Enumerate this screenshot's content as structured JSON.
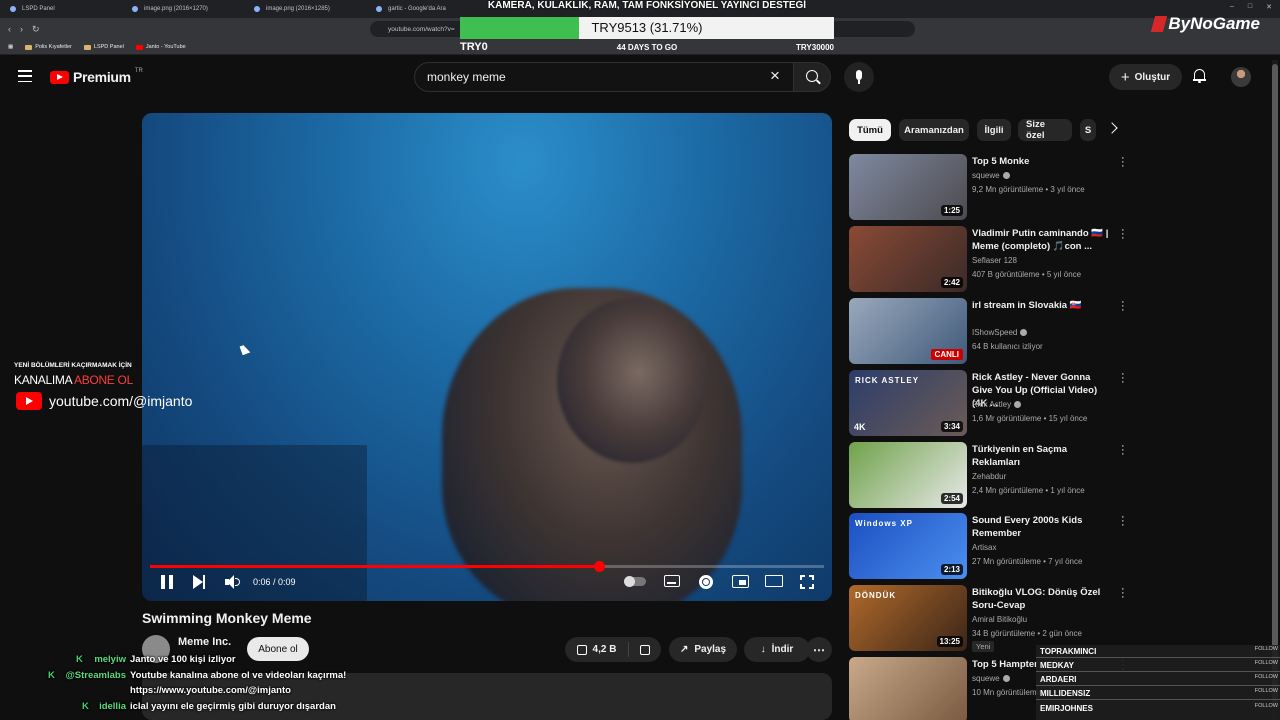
{
  "browser": {
    "tabs": [
      {
        "label": "LSPD Panel"
      },
      {
        "label": "image.png (2016×1270)"
      },
      {
        "label": "image.png (2016×1285)"
      },
      {
        "label": "gartic - Google'da Ara"
      }
    ],
    "url": "youtube.com/watch?v=",
    "bookmarks": [
      {
        "label": "Polis Kıyafetler"
      },
      {
        "label": "LSPD Panel"
      },
      {
        "label": "Janto - YouTube"
      }
    ]
  },
  "donation": {
    "title": "KAMERA, KULAKLIK, RAM, TAM FONKSİYONEL YAYINCI DESTEĞİ",
    "progress_text": "TRY9513 (31.71%)",
    "progress_fraction": 0.3171,
    "min_label": "TRY0",
    "days_left": "44 DAYS TO GO",
    "max_label": "TRY30000"
  },
  "brand_logo": "ByNoGame",
  "header": {
    "logo_text": "Premium",
    "country_code": "TR",
    "search_value": "monkey meme",
    "create_label": "Oluştur"
  },
  "player": {
    "time": "0:06 / 0:09",
    "progress_fraction": 0.6667
  },
  "video": {
    "title": "Swimming Monkey Meme",
    "channel": "Meme Inc.",
    "subscribe_label": "Abone ol",
    "likes": "4,2 B",
    "share_label": "Paylaş",
    "download_label": "İndir"
  },
  "chips": [
    "Tümü",
    "Aramanızdan",
    "İlgili",
    "Size özel",
    "S"
  ],
  "recommendations": [
    {
      "title": "Top 5 Monke",
      "channel": "squewe",
      "verified": true,
      "meta": "9,2 Mn görüntüleme • 3 yıl önce",
      "duration": "1:25",
      "thumb": [
        "#7e8aa0",
        "#4d4a4f"
      ]
    },
    {
      "title": "Vladimir Putin caminando 🇷🇺 | Meme (completo) 🎵con ...",
      "channel": "Seflaser 128",
      "verified": false,
      "meta": "407 B görüntüleme • 5 yıl önce",
      "duration": "2:42",
      "thumb": [
        "#8a4a35",
        "#3a2a28"
      ]
    },
    {
      "title": "irl stream in Slovakia 🇸🇰",
      "channel": "IShowSpeed",
      "verified": true,
      "meta": "64 B kullanıcı izliyor",
      "live": "CANLI",
      "thumb": [
        "#9aa9bc",
        "#3f5a7a"
      ]
    },
    {
      "title": "Rick Astley - Never Gonna Give You Up (Official Video) (4K ...",
      "channel": "Rick Astley",
      "verified": true,
      "meta": "1,6 Mr görüntüleme • 15 yıl önce",
      "duration": "3:34",
      "thumb_text": "RICK ASTLEY",
      "thumb_badge": "4K",
      "thumb": [
        "#2c3d6a",
        "#6b5b57"
      ]
    },
    {
      "title": "Türkiyenin en Saçma Reklamları",
      "channel": "Zehabdur",
      "verified": false,
      "meta": "2,4 Mn görüntüleme • 1 yıl önce",
      "duration": "2:54",
      "thumb": [
        "#6fa24a",
        "#e8e8e8"
      ]
    },
    {
      "title": "Sound Every 2000s Kids Remember",
      "channel": "Artisax",
      "verified": false,
      "meta": "27 Mn görüntüleme • 7 yıl önce",
      "duration": "2:13",
      "thumb_text": "Windows XP",
      "thumb": [
        "#1c4fc0",
        "#4b8ff0"
      ]
    },
    {
      "title": "Bitikoğlu VLOG: Dönüş Özel Soru-Cevap",
      "channel": "Amiral Bitikoğlu",
      "verified": false,
      "meta": "34 B görüntüleme • 2 gün önce",
      "duration": "13:25",
      "thumb_text": "DÖNDÜK",
      "badge": "Yeni",
      "thumb": [
        "#b06a2a",
        "#3b2518"
      ]
    },
    {
      "title": "Top 5 Hampter",
      "channel": "squewe",
      "verified": true,
      "meta": "10 Mn görüntüleme",
      "thumb": [
        "#c9a98a",
        "#7a5a40"
      ]
    }
  ],
  "overlay": {
    "small": "YENİ BÖLÜMLERİ KAÇIRMAMAK İÇİN",
    "big_prefix": "KANALIMA ",
    "big_red": "ABONE OL",
    "url": "youtube.com/@imjanto"
  },
  "chat": [
    {
      "user": "melyiw",
      "message": "Janto ve 100 kişi izliyor"
    },
    {
      "user": "@Streamlabs",
      "message": "Youtube kanalına abone ol ve videoları kaçırma!"
    },
    {
      "user": "",
      "message": "https://www.youtube.com/@imjanto"
    },
    {
      "user": "idellia",
      "message": "iclal yayını ele geçirmiş gibi duruyor dışardan"
    }
  ],
  "followers": [
    {
      "name": "TOPRAKMINCI",
      "tag": "FOLLOW"
    },
    {
      "name": "MEDKAY",
      "tag": "FOLLOW"
    },
    {
      "name": "ARDAERI",
      "tag": "FOLLOW"
    },
    {
      "name": "MILLIDENSIZ",
      "tag": "FOLLOW"
    },
    {
      "name": "EMIRJOHNES",
      "tag": "FOLLOW"
    }
  ]
}
